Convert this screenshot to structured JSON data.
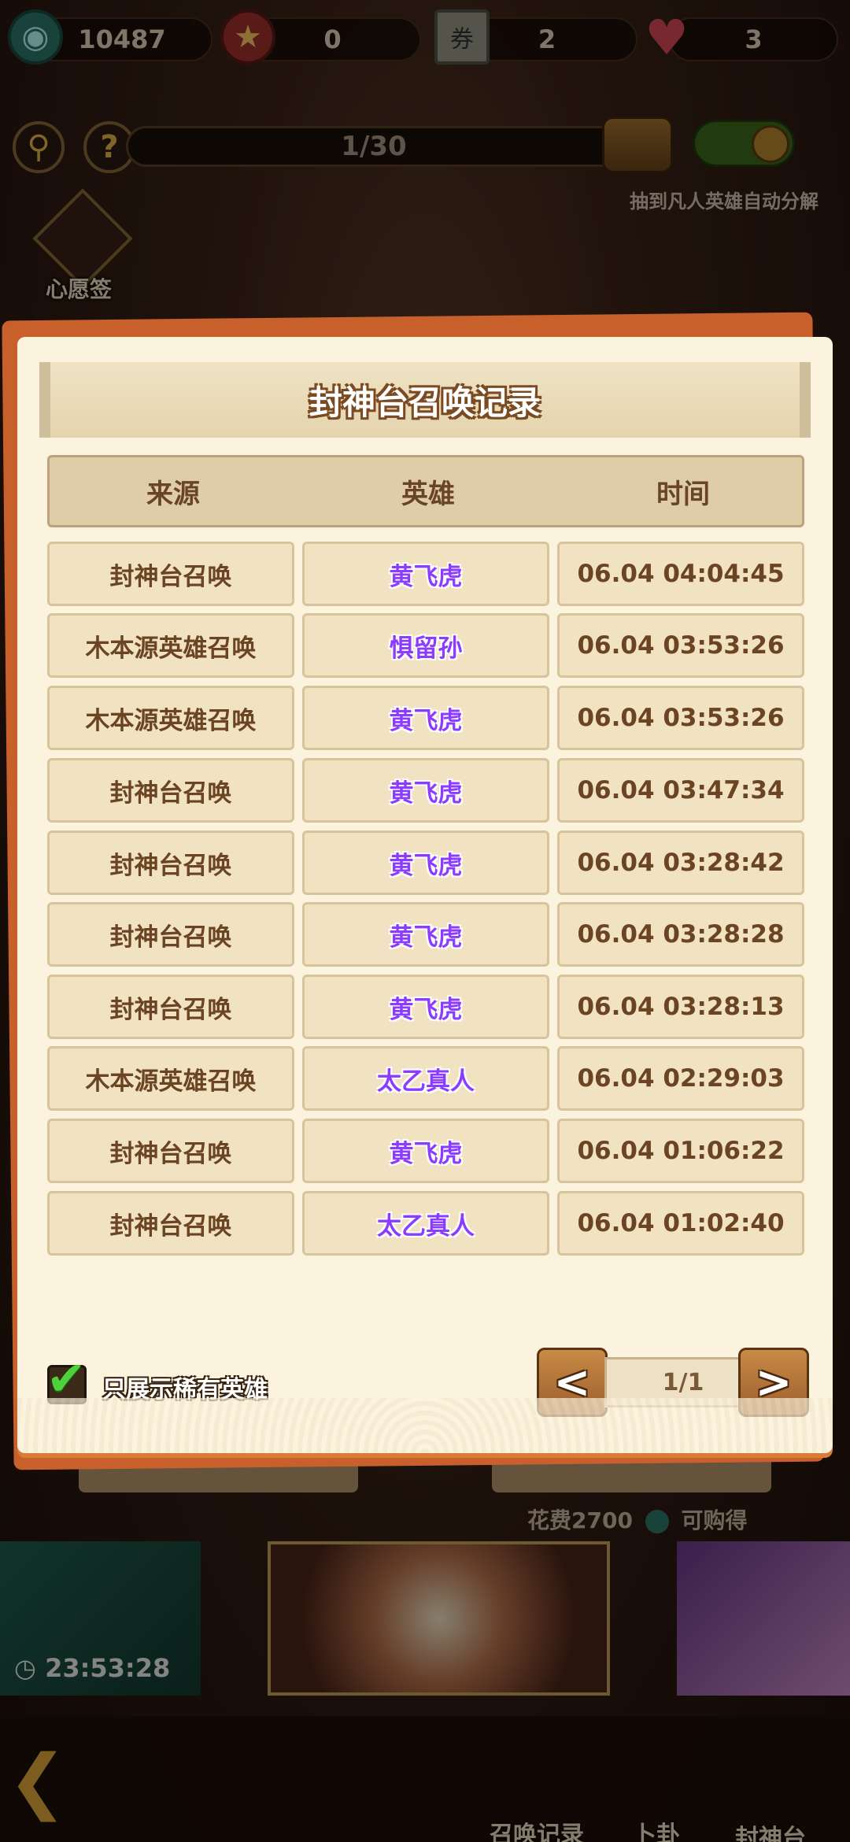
{
  "resources": {
    "jade": "10487",
    "bag": "0",
    "ticket": "2",
    "hearts": "3"
  },
  "toolbar": {
    "search_icon": "search-icon",
    "help_glyph": "?",
    "progress": "1/30",
    "progress_value": 0.033,
    "auto_decompose_label": "抽到凡人英雄自动分解",
    "auto_decompose_on": true
  },
  "wish": {
    "label": "心愿签"
  },
  "dialog": {
    "title": "封神台召唤记录",
    "headers": [
      "来源",
      "英雄",
      "时间"
    ],
    "rows": [
      {
        "source": "封神台召唤",
        "hero": "黄飞虎",
        "time": "06.04 04:04:45"
      },
      {
        "source": "木本源英雄召唤",
        "hero": "惧留孙",
        "time": "06.04 03:53:26"
      },
      {
        "source": "木本源英雄召唤",
        "hero": "黄飞虎",
        "time": "06.04 03:53:26"
      },
      {
        "source": "封神台召唤",
        "hero": "黄飞虎",
        "time": "06.04 03:47:34"
      },
      {
        "source": "封神台召唤",
        "hero": "黄飞虎",
        "time": "06.04 03:28:42"
      },
      {
        "source": "封神台召唤",
        "hero": "黄飞虎",
        "time": "06.04 03:28:28"
      },
      {
        "source": "封神台召唤",
        "hero": "黄飞虎",
        "time": "06.04 03:28:13"
      },
      {
        "source": "木本源英雄召唤",
        "hero": "太乙真人",
        "time": "06.04 02:29:03"
      },
      {
        "source": "封神台召唤",
        "hero": "黄飞虎",
        "time": "06.04 01:06:22"
      },
      {
        "source": "封神台召唤",
        "hero": "太乙真人",
        "time": "06.04 01:02:40"
      }
    ],
    "filter_label": "只展示稀有英雄",
    "filter_checked": true,
    "prev_label": "<",
    "next_label": ">",
    "page": "1/1"
  },
  "behind": {
    "cost_text": "花费2700",
    "buy_text": "可购得",
    "timer": "23:53:28"
  },
  "nav": {
    "records": "召唤记录",
    "divination": "卜卦",
    "platform": "封神台"
  },
  "colors": {
    "hero_purple": "#8b3cff",
    "panel": "#fbf3dd",
    "accent_orange": "#c8602c"
  }
}
